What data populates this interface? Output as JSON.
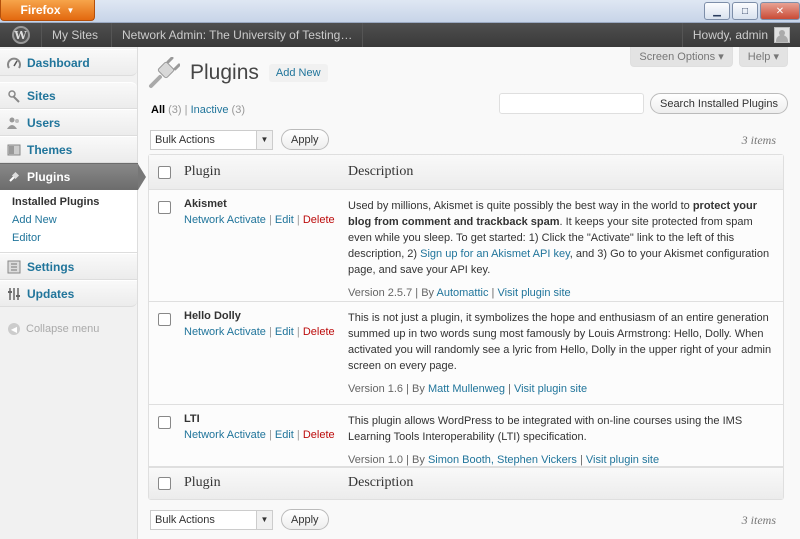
{
  "browser": {
    "app_button": "Firefox",
    "controls": [
      "minimize-icon",
      "maximize-icon",
      "close-icon"
    ]
  },
  "adminbar": {
    "my_sites": "My Sites",
    "network_admin": "Network Admin: The University of Testing…",
    "howdy": "Howdy, admin"
  },
  "sidebar": {
    "dashboard": "Dashboard",
    "sites": "Sites",
    "users": "Users",
    "themes": "Themes",
    "plugins": "Plugins",
    "submenu": [
      "Installed Plugins",
      "Add New",
      "Editor"
    ],
    "settings": "Settings",
    "updates": "Updates",
    "collapse": "Collapse menu"
  },
  "header": {
    "screen_options": "Screen Options",
    "help": "Help",
    "title": "Plugins",
    "add_new": "Add New"
  },
  "filters": {
    "all_label": "All",
    "all_count": "(3)",
    "inactive_label": "Inactive",
    "inactive_count": "(3)"
  },
  "search": {
    "button": "Search Installed Plugins",
    "value": ""
  },
  "bulk": {
    "selected": "Bulk Actions",
    "apply": "Apply",
    "count": "3 items"
  },
  "table": {
    "col_plugin": "Plugin",
    "col_description": "Description",
    "rows": [
      {
        "name": "Akismet",
        "actions": [
          "Network Activate",
          "Edit",
          "Delete"
        ],
        "desc_1": "Used by millions, Akismet is quite possibly the best way in the world to ",
        "desc_bold": "protect your blog from comment and trackback spam",
        "desc_2": ". It keeps your site protected from spam even while you sleep. To get started: 1) Click the \"Activate\" link to the left of this description, 2) ",
        "desc_link": "Sign up for an Akismet API key",
        "desc_3": ", and 3) Go to your Akismet configuration page, and save your API key.",
        "version": "Version 2.5.7",
        "by": "By",
        "author": "Automattic",
        "site": "Visit plugin site"
      },
      {
        "name": "Hello Dolly",
        "actions": [
          "Network Activate",
          "Edit",
          "Delete"
        ],
        "desc": "This is not just a plugin, it symbolizes the hope and enthusiasm of an entire generation summed up in two words sung most famously by Louis Armstrong: Hello, Dolly. When activated you will randomly see a lyric from Hello, Dolly in the upper right of your admin screen on every page.",
        "version": "Version 1.6",
        "by": "By",
        "author": "Matt Mullenweg",
        "site": "Visit plugin site"
      },
      {
        "name": "LTI",
        "actions": [
          "Network Activate",
          "Edit",
          "Delete"
        ],
        "desc": "This plugin allows WordPress to be integrated with on-line courses using the IMS Learning Tools Interoperability (LTI) specification.",
        "version": "Version 1.0",
        "by": "By",
        "author": "Simon Booth, Stephen Vickers",
        "site": "Visit plugin site"
      }
    ]
  }
}
